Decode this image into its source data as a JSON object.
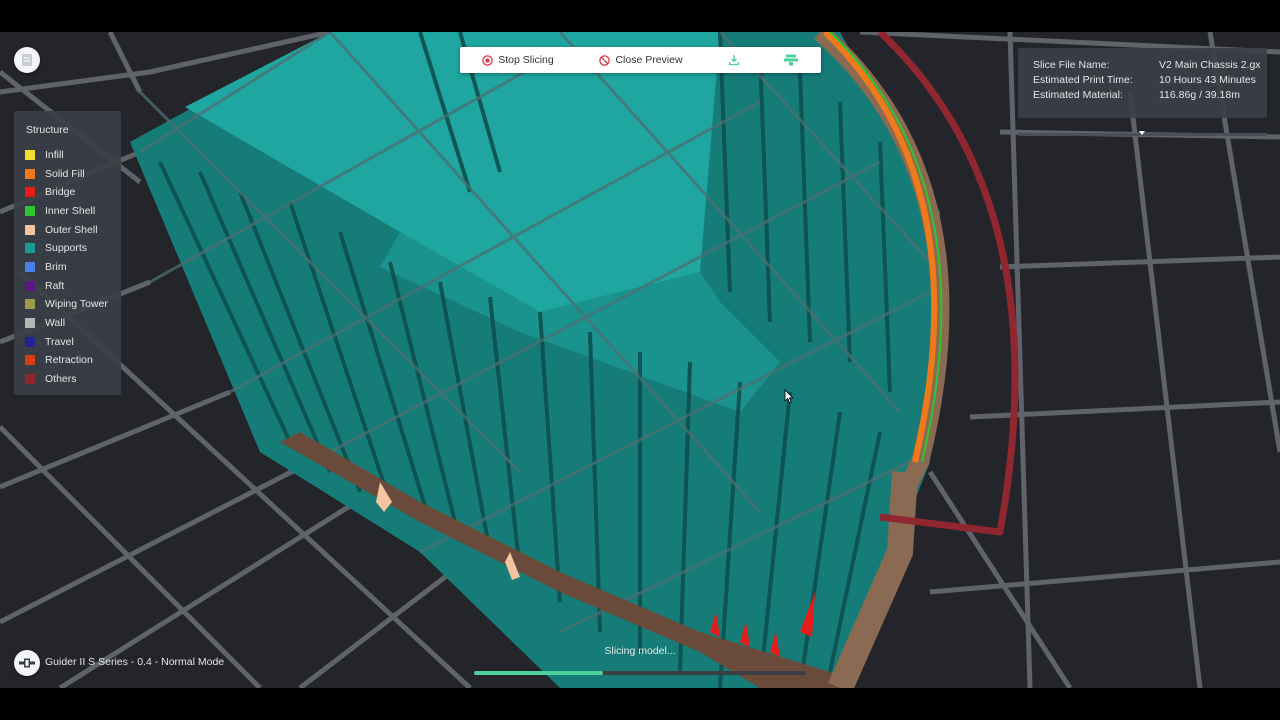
{
  "toolbar": {
    "stop_label": "Stop Slicing",
    "close_label": "Close Preview",
    "download_icon": "download-icon",
    "print_icon": "print-icon"
  },
  "legend": {
    "title": "Structure",
    "items": [
      {
        "label": "Infill",
        "color": "#f2dc2e"
      },
      {
        "label": "Solid Fill",
        "color": "#f07a1a"
      },
      {
        "label": "Bridge",
        "color": "#e41c1c"
      },
      {
        "label": "Inner Shell",
        "color": "#2fc630"
      },
      {
        "label": "Outer Shell",
        "color": "#f4c3a0"
      },
      {
        "label": "Supports",
        "color": "#1c9b96"
      },
      {
        "label": "Brim",
        "color": "#4a7fe8"
      },
      {
        "label": "Raft",
        "color": "#5c1880"
      },
      {
        "label": "Wiping Tower",
        "color": "#9c9c4a"
      },
      {
        "label": "Wall",
        "color": "#b6b6b6"
      },
      {
        "label": "Travel",
        "color": "#23228f"
      },
      {
        "label": "Retraction",
        "color": "#d93c14"
      },
      {
        "label": "Others",
        "color": "#8f2630"
      }
    ]
  },
  "info": {
    "rows": [
      {
        "label": "Slice File Name:",
        "value": "V2 Main Chassis 2.gx"
      },
      {
        "label": "Estimated Print Time:",
        "value": "10 Hours 43 Minutes"
      },
      {
        "label": "Estimated Material:",
        "value": "116.86g / 39.18m"
      }
    ]
  },
  "printer": {
    "label": "Guider II S Series - 0.4 - Normal Mode"
  },
  "status": {
    "text": "Slicing model...",
    "progress": 0.39
  },
  "colors": {
    "support_teal": "#1c9b96",
    "progress": "#4ed09a",
    "panel_bg": "#3a3e46",
    "viewport_bg": "#24252b"
  }
}
